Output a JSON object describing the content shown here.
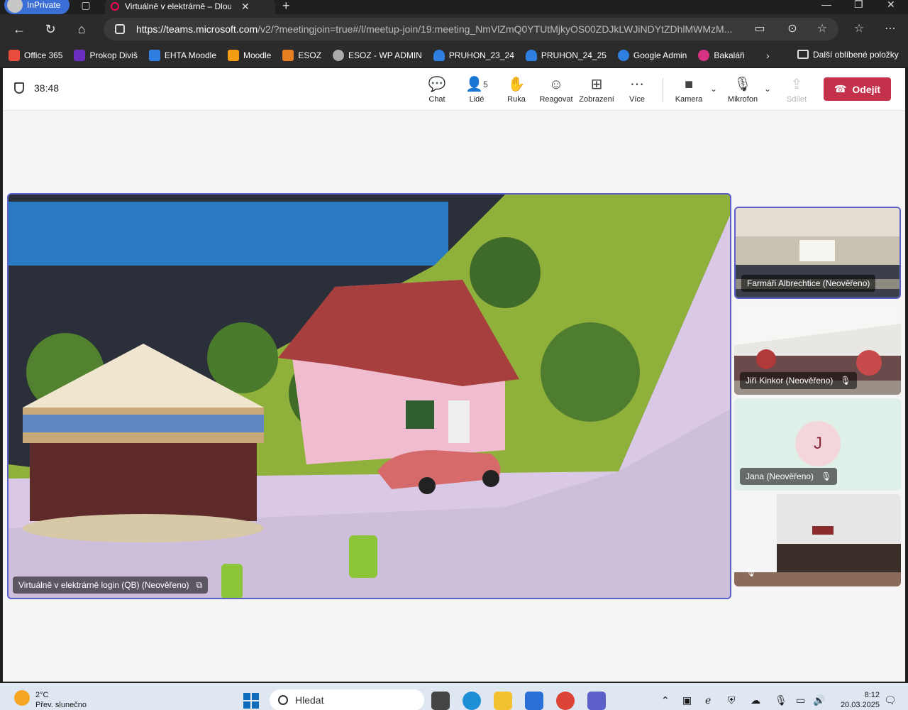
{
  "browser": {
    "inprivate_label": "InPrivate",
    "tab_title": "Virtuálně v elektrárně – Dlouh",
    "url_host": "https://teams.microsoft.com",
    "url_path": "/v2/?meetingjoin=true#/l/meetup-join/19:meeting_NmVlZmQ0YTUtMjkyOS00ZDJkLWJiNDYtZDhlMWMzM..."
  },
  "bookmarks": [
    {
      "label": "Office 365",
      "color": "#e74c3c"
    },
    {
      "label": "Prokop Diviš",
      "color": "#6b2fbf"
    },
    {
      "label": "EHTA Moodle",
      "color": "#2f7fe0"
    },
    {
      "label": "Moodle",
      "color": "#f39c12"
    },
    {
      "label": "ESOZ",
      "color": "#e67e22"
    },
    {
      "label": "ESOZ - WP ADMIN",
      "color": "#aaaaaa"
    },
    {
      "label": "PRUHON_23_24",
      "color": "#2f7fe0"
    },
    {
      "label": "PRUHON_24_25",
      "color": "#2f7fe0"
    },
    {
      "label": "Google Admin",
      "color": "#2f7fe0"
    },
    {
      "label": "Bakaláři",
      "color": "#d63384"
    }
  ],
  "bookmarks_other": "Další oblíbené položky",
  "meeting": {
    "timer": "38:48",
    "people_count": "5",
    "tools": {
      "chat": "Chat",
      "people": "Lidé",
      "hand": "Ruka",
      "react": "Reagovat",
      "view": "Zobrazení",
      "more": "Více",
      "camera": "Kamera",
      "mic": "Mikrofon",
      "share": "Sdílet"
    },
    "leave_label": "Odejít",
    "main_participant": "Virtuálně v elektrárně login (QB) (Neověřeno)",
    "participants": [
      {
        "name": "Farmáři Albrechtice (Neověřeno)"
      },
      {
        "name": "Jiří Kinkor (Neověřeno)"
      },
      {
        "name": "Jana (Neověřeno)",
        "initial": "J"
      },
      {
        "name": ""
      }
    ]
  },
  "taskbar": {
    "temp": "2°C",
    "weather": "Přev. slunečno",
    "search_placeholder": "Hledat",
    "time": "8:12",
    "date": "20.03.2025"
  }
}
